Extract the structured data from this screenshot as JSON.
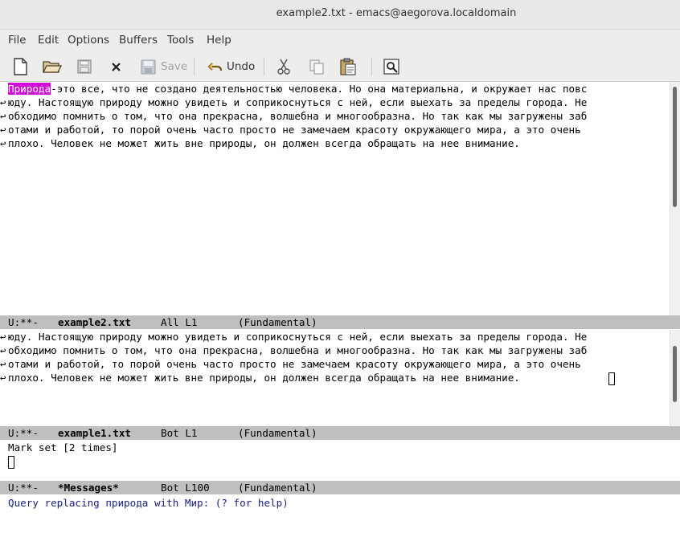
{
  "window": {
    "title": "example2.txt - emacs@aegorova.localdomain"
  },
  "menu": [
    "File",
    "Edit",
    "Options",
    "Buffers",
    "Tools",
    "Help"
  ],
  "toolbar": {
    "new_icon": "new-file-icon",
    "open_icon": "open-folder-icon",
    "save_icon": "save-disk-icon",
    "close_icon": "close-x-icon",
    "save_label": "Save",
    "undo_label": "Undo",
    "cut_icon": "scissors-icon",
    "copy_icon": "copy-icon",
    "paste_icon": "paste-icon",
    "search_icon": "search-icon"
  },
  "top_window": {
    "highlight": "Природа",
    "line1_rest": "-это все, что не создано деятельностью человека. Но она материальна, и окружает нас повс",
    "line2": "юду. Настоящую природу можно увидеть и соприкоснуться с ней, если выехать за пределы города. Не",
    "line3": "обходимо помнить о том, что она прекрасна, волшебна и многообразна. Но так как мы загружены заб",
    "line4": "отами и работой, то порой очень часто просто не замечаем красоту окружающего мира, а это очень ",
    "line5": "плохо. Человек не может жить вне природы, он должен всегда обращать на нее внимание.",
    "modeline": {
      "status": "U:**-",
      "buffer": "example2.txt",
      "position": "All L1",
      "mode": "(Fundamental)"
    }
  },
  "bottom_window": {
    "line1": "юду. Настоящую природу можно увидеть и соприкоснуться с ней, если выехать за пределы города. Не",
    "line2": "обходимо помнить о том, что она прекрасна, волшебна и многообразна. Но так как мы загружены заб",
    "line3": "отами и работой, то порой очень часто просто не замечаем красоту окружающего мира, а это очень ",
    "line4": "плохо. Человек не может жить вне природы, он должен всегда обращать на нее внимание.",
    "modeline": {
      "status": "U:**-",
      "buffer": "example1.txt",
      "position": "Bot L1",
      "mode": "(Fundamental)"
    }
  },
  "messages_window": {
    "line1": "Mark set [2 times]",
    "modeline": {
      "status": "U:**-",
      "buffer": "*Messages*",
      "position": "Bot L100",
      "mode": "(Fundamental)"
    }
  },
  "minibuffer": {
    "prompt": "Query replacing природа with Мир: (? for help)"
  },
  "colors": {
    "highlight_bg": "#d20bd6",
    "modeline_bg": "#bfbfbf",
    "minibuffer_prompt": "#1a237e"
  }
}
